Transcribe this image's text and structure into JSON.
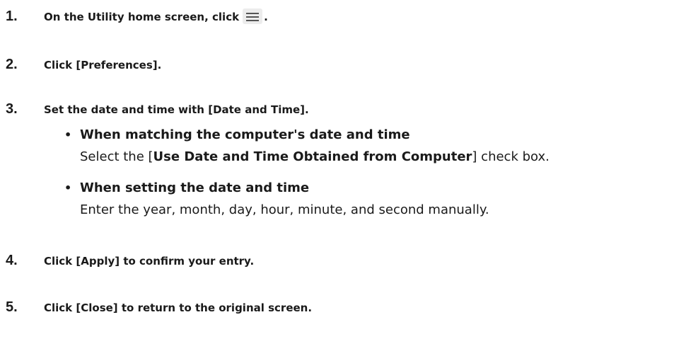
{
  "steps": [
    {
      "num": "1.",
      "text_before": "On the Utility home screen, click",
      "icon": "hamburger-menu-icon",
      "text_after": "."
    },
    {
      "num": "2.",
      "text": "Click [Preferences]."
    },
    {
      "num": "3.",
      "text": "Set the date and time with [Date and Time]."
    },
    {
      "num": "4.",
      "text": "Click [Apply] to confirm your entry."
    },
    {
      "num": "5.",
      "text": "Click [Close] to return to the original screen."
    }
  ],
  "bullets": [
    {
      "dot": "•",
      "title": "When matching the computer's date and time",
      "desc_prefix": "Select the [",
      "desc_bold": "Use Date and Time Obtained from Computer",
      "desc_suffix": "] check box."
    },
    {
      "dot": "•",
      "title": "When setting the date and time",
      "desc": "Enter the year, month, day, hour, minute, and second manually."
    }
  ]
}
